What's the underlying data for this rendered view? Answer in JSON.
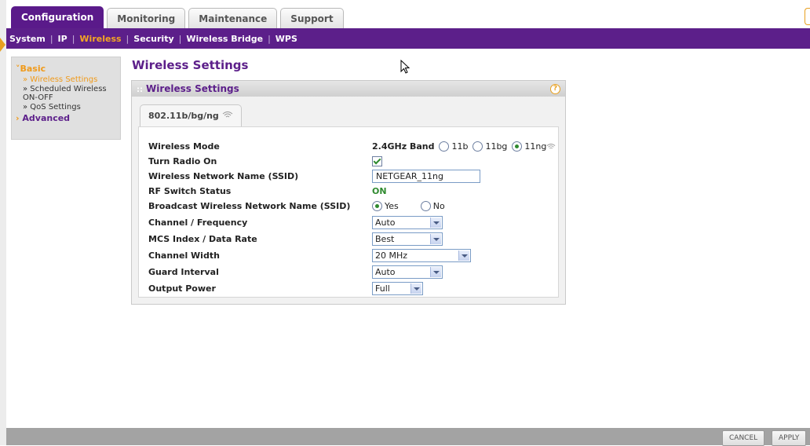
{
  "tabs": [
    {
      "label": "Configuration",
      "active": true
    },
    {
      "label": "Monitoring",
      "active": false
    },
    {
      "label": "Maintenance",
      "active": false
    },
    {
      "label": "Support",
      "active": false
    }
  ],
  "subnav": [
    "System",
    "IP",
    "Wireless",
    "Security",
    "Wireless Bridge",
    "WPS"
  ],
  "sidebar": {
    "basic_label": "Basic",
    "items": [
      "» Wireless Settings",
      "» Scheduled Wireless ON-OFF",
      "» QoS Settings"
    ],
    "advanced_label": "Advanced"
  },
  "page_title": "Wireless Settings",
  "panel": {
    "title": "Wireless Settings",
    "tab_label": "802.11b/bg/ng"
  },
  "form": {
    "wireless_mode": {
      "label": "Wireless Mode",
      "band": "2.4GHz Band",
      "options": [
        "11b",
        "11bg",
        "11ng"
      ],
      "selected": "11ng"
    },
    "turn_radio_on": {
      "label": "Turn Radio On",
      "checked": true
    },
    "ssid": {
      "label": "Wireless Network Name (SSID)",
      "value": "NETGEAR_11ng"
    },
    "rf_switch": {
      "label": "RF Switch Status",
      "value": "ON"
    },
    "broadcast": {
      "label": "Broadcast Wireless Network Name (SSID)",
      "yes": "Yes",
      "no": "No",
      "selected": "Yes"
    },
    "channel": {
      "label": "Channel / Frequency",
      "value": "Auto"
    },
    "mcs": {
      "label": "MCS Index / Data Rate",
      "value": "Best"
    },
    "width": {
      "label": "Channel Width",
      "value": "20 MHz"
    },
    "guard": {
      "label": "Guard Interval",
      "value": "Auto"
    },
    "power": {
      "label": "Output Power",
      "value": "Full"
    }
  },
  "buttons": {
    "cancel": "CANCEL",
    "apply": "APPLY"
  },
  "colors": {
    "brand_purple": "#5c1f8a",
    "accent_orange": "#f09a1a",
    "on_green": "#2f8a2f"
  }
}
